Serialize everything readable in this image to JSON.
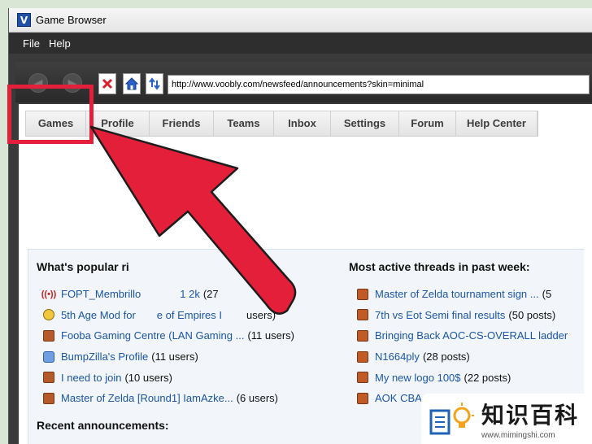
{
  "window": {
    "title": "Game Browser",
    "logo_letter": "V"
  },
  "menu": [
    "File",
    "Help"
  ],
  "toolbar": {
    "url": "http://www.voobly.com/newsfeed/announcements?skin=minimal"
  },
  "nav": [
    "Games",
    "Profile",
    "Friends",
    "Teams",
    "Inbox",
    "Settings",
    "Forum",
    "Help Center"
  ],
  "popular": {
    "title": "What's popular ri",
    "items": [
      {
        "icon": "live-broadcast-icon",
        "name": "FOPT_Membrillo",
        "tail": "1 2k",
        "count": "(27"
      },
      {
        "icon": "mod-icon",
        "name": "5th Age Mod for",
        "tail": "e of Empires I",
        "count": "users)"
      },
      {
        "icon": "game-lobby-icon",
        "name": "Fooba Gaming Centre (LAN Gaming ...",
        "tail": "",
        "count": "(11 users)"
      },
      {
        "icon": "user-profile-icon",
        "name": "BumpZilla's Profile",
        "tail": "",
        "count": "(11 users)"
      },
      {
        "icon": "game-lobby-icon",
        "name": "I need to join",
        "tail": "",
        "count": "(10 users)"
      },
      {
        "icon": "game-lobby-icon",
        "name": "Master of Zelda [Round1] IamAzke...",
        "tail": "",
        "count": "(6 users)"
      }
    ]
  },
  "threads": {
    "title": "Most active threads in past week:",
    "items": [
      {
        "name": "Master of Zelda tournament sign ...",
        "count": "(5"
      },
      {
        "name": "7th vs Eot Semi final results",
        "count": "(50 posts)"
      },
      {
        "name": "Bringing Back AOC-CS-OVERALL ladder",
        "count": ""
      },
      {
        "name": "N1664ply",
        "count": "(28 posts)"
      },
      {
        "name": "My new logo 100$",
        "count": "(22 posts)"
      },
      {
        "name": "AOK CBA",
        "count": ""
      }
    ]
  },
  "announcements": {
    "title": "Recent announcements:"
  },
  "watermark": {
    "brand": "知识百科",
    "url": "www.mimingshi.com"
  },
  "colors": {
    "arrow": "#e31f3a",
    "link": "#1a55a6",
    "menubar": "#2e2e2e"
  }
}
